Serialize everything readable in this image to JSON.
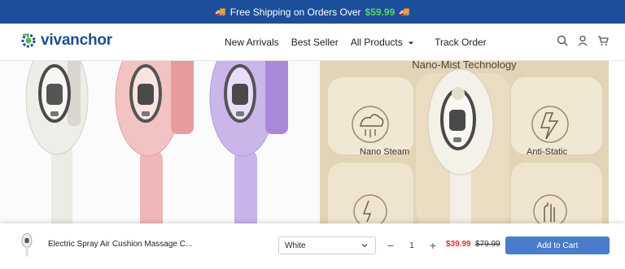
{
  "announcement": {
    "text": "Free Shipping on Orders Over",
    "price": "$59.99",
    "icon_left": "truck-icon",
    "icon_right": "truck-icon"
  },
  "header": {
    "logo_text": "vivanchor",
    "logo_icon": "gear-leaf-logo-icon",
    "nav": [
      "New Arrivals",
      "Best Seller",
      "All Products",
      "Track Order"
    ],
    "icons": [
      "search-icon",
      "account-icon",
      "cart-icon"
    ]
  },
  "hero": {
    "right_title": "Nano-Mist Technology",
    "features": [
      "Nano Steam",
      "Anti-Static"
    ]
  },
  "sticky_cart": {
    "product_name": "Electric Spray Air Cushion Massage C...",
    "variant": "White",
    "quantity": "1",
    "sale_price": "$39.99",
    "original_price": "$79.99",
    "button_label": "Add to Cart"
  },
  "colors": {
    "announcement_bg": "#1b4e9b",
    "price_accent": "#59d36b",
    "brand": "#1f4f8f",
    "sale_red": "#e0322f",
    "button_blue": "#4a7cc9"
  }
}
